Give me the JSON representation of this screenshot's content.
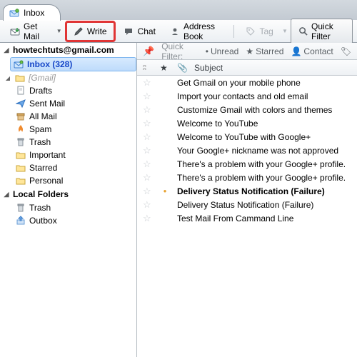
{
  "tab": {
    "title": "Inbox"
  },
  "toolbar": {
    "get_mail": "Get Mail",
    "write": "Write",
    "chat": "Chat",
    "address_book": "Address Book",
    "tag": "Tag",
    "quick_filter": "Quick Filter"
  },
  "account": "howtechtuts@gmail.com",
  "tree": {
    "inbox": "Inbox (328)",
    "gmail": "[Gmail]",
    "drafts": "Drafts",
    "sent": "Sent Mail",
    "all": "All Mail",
    "spam": "Spam",
    "trash": "Trash",
    "important": "Important",
    "starred": "Starred",
    "personal": "Personal",
    "local": "Local Folders",
    "ltrash": "Trash",
    "outbox": "Outbox"
  },
  "qf": {
    "label": "Quick Filter:",
    "unread": "Unread",
    "starred": "Starred",
    "contact": "Contact"
  },
  "cols": {
    "subject": "Subject"
  },
  "messages": [
    {
      "subject": "Get Gmail on your mobile phone",
      "bold": false,
      "dot": false
    },
    {
      "subject": "Import your contacts and old email",
      "bold": false,
      "dot": false
    },
    {
      "subject": "Customize Gmail with colors and themes",
      "bold": false,
      "dot": false
    },
    {
      "subject": "Welcome to YouTube",
      "bold": false,
      "dot": false
    },
    {
      "subject": "Welcome to YouTube with Google+",
      "bold": false,
      "dot": false
    },
    {
      "subject": "Your Google+ nickname was not approved",
      "bold": false,
      "dot": false
    },
    {
      "subject": "There's a problem with your Google+ profile.",
      "bold": false,
      "dot": false
    },
    {
      "subject": "There's a problem with your Google+ profile.",
      "bold": false,
      "dot": false
    },
    {
      "subject": "Delivery Status Notification (Failure)",
      "bold": true,
      "dot": true
    },
    {
      "subject": "Delivery Status Notification (Failure)",
      "bold": false,
      "dot": false
    },
    {
      "subject": "Test Mail From Cammand Line",
      "bold": false,
      "dot": false
    }
  ]
}
